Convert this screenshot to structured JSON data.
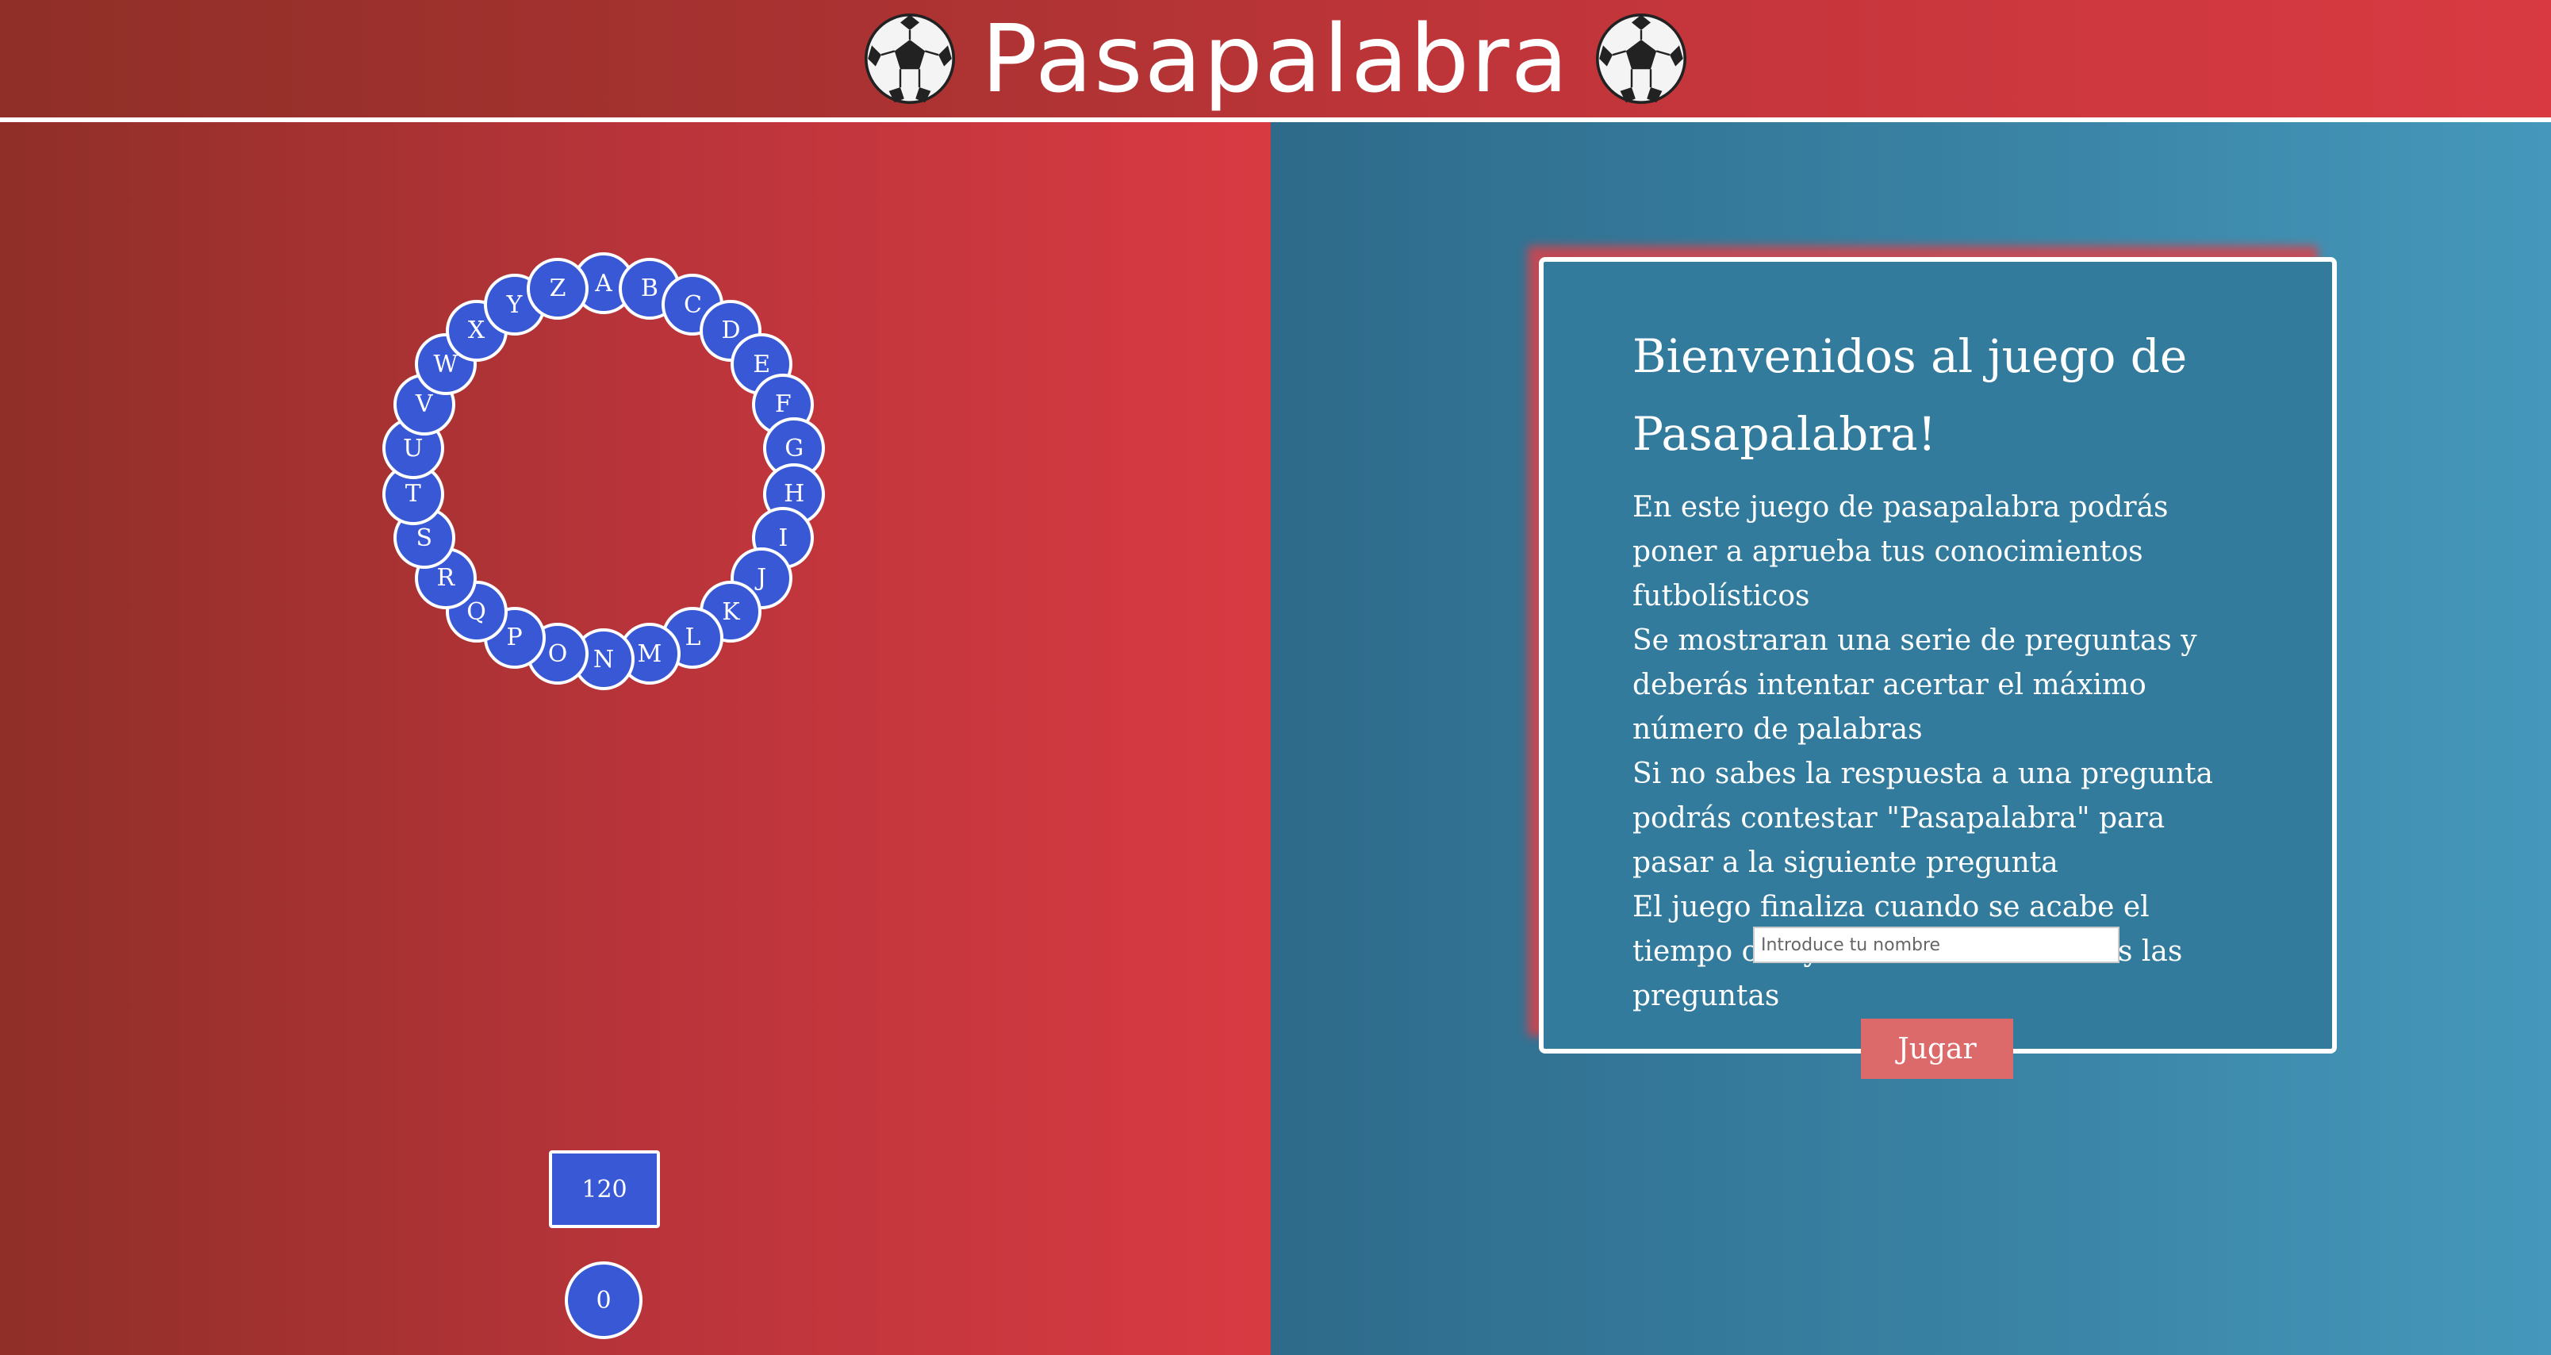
{
  "header": {
    "title": "Pasapalabra",
    "left_icon": "soccer-ball-icon",
    "right_icon": "soccer-ball-icon"
  },
  "rosco": {
    "letters": [
      "A",
      "B",
      "C",
      "D",
      "E",
      "F",
      "G",
      "H",
      "I",
      "J",
      "K",
      "L",
      "M",
      "N",
      "O",
      "P",
      "Q",
      "R",
      "S",
      "T",
      "U",
      "V",
      "W",
      "X",
      "Y",
      "Z"
    ],
    "timer": "120",
    "score": "0",
    "letter_color": "#3858d6"
  },
  "welcome": {
    "title": "Bienvenidos al juego de Pasapalabra!",
    "paragraphs": [
      "En este juego de pasapalabra podrás poner a aprueba tus conocimientos futbolísticos",
      "Se mostraran una serie de preguntas y deberás intentar acertar el máximo número de palabras",
      "Si no sabes la respuesta a una pregunta podrás contestar \"Pasapalabra\" para pasar a la siguiente pregunta",
      "El juego finaliza cuando se acabe el tiempo o hayas contestado a todas las preguntas"
    ],
    "name_placeholder": "Introduce tu nombre",
    "name_value": "",
    "play_label": "Jugar"
  },
  "colors": {
    "header_red": "#c0353a",
    "panel_blue": "#3a84a6",
    "button_pink": "#dc6a6a"
  }
}
